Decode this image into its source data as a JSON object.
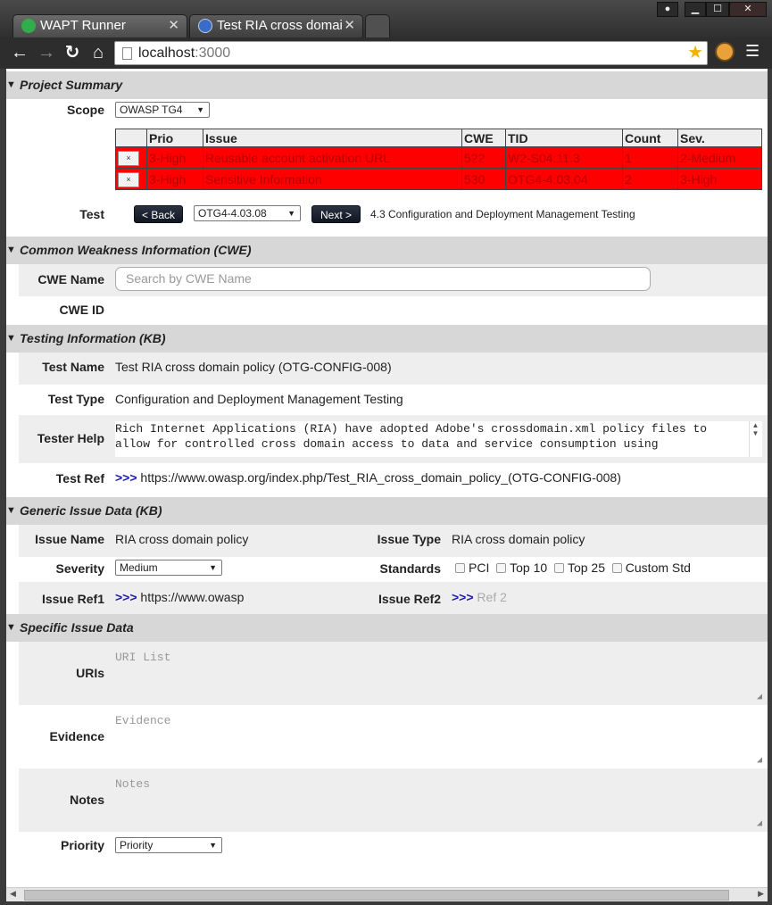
{
  "browser": {
    "tabs": [
      {
        "title": "WAPT Runner",
        "active": false
      },
      {
        "title": "Test RIA cross domai",
        "active": true
      }
    ],
    "url_host": "localhost",
    "url_port": ":3000",
    "icons": {
      "back": "back-arrow-icon",
      "forward": "forward-arrow-icon",
      "reload": "reload-icon",
      "home": "home-icon",
      "star": "star-icon",
      "menu": "menu-icon"
    }
  },
  "project_summary": {
    "header": "Project Summary",
    "scope_label": "Scope",
    "scope_value": "OWASP TG4",
    "table": {
      "columns": [
        "",
        "Prio",
        "Issue",
        "CWE",
        "TID",
        "Count",
        "Sev."
      ],
      "rows": [
        {
          "remove": "×",
          "prio": "3-High",
          "issue": "Reusable account activation URL",
          "cwe": "522",
          "tid": "W2-S04.11.3",
          "count": "1",
          "sev": "2-Medium"
        },
        {
          "remove": "×",
          "prio": "3-High",
          "issue": "Sensitive Information",
          "cwe": "530",
          "tid": "OTG4-4.03.04",
          "count": "2",
          "sev": "3-High"
        }
      ]
    },
    "test_label": "Test",
    "back_button": "< Back",
    "test_select": "OTG4-4.03.08",
    "next_button": "Next >",
    "test_category": "4.3 Configuration and Deployment Management Testing"
  },
  "cwe": {
    "header": "Common Weakness Information (CWE)",
    "name_label": "CWE Name",
    "name_placeholder": "Search by CWE Name",
    "id_label": "CWE ID"
  },
  "testing": {
    "header": "Testing Information (KB)",
    "test_name_label": "Test Name",
    "test_name": "Test RIA cross domain policy (OTG-CONFIG-008)",
    "test_type_label": "Test Type",
    "test_type": "Configuration and Deployment Management Testing",
    "tester_help_label": "Tester Help",
    "tester_help_line1": "Rich Internet Applications (RIA) have adopted Adobe's crossdomain.xml policy files to",
    "tester_help_line2": "allow for controlled cross domain access to data and service consumption using",
    "test_ref_label": "Test Ref",
    "test_ref_arrows": ">>>",
    "test_ref": "https://www.owasp.org/index.php/Test_RIA_cross_domain_policy_(OTG-CONFIG-008)"
  },
  "generic": {
    "header": "Generic Issue Data (KB)",
    "issue_name_label": "Issue Name",
    "issue_name": "RIA cross domain policy",
    "issue_type_label": "Issue Type",
    "issue_type": "RIA cross domain policy",
    "severity_label": "Severity",
    "severity_value": "Medium",
    "standards_label": "Standards",
    "standards": [
      "PCI",
      "Top 10",
      "Top 25",
      "Custom Std"
    ],
    "issue_ref1_label": "Issue Ref1",
    "issue_ref1_arrows": ">>>",
    "issue_ref1": "https://www.owasp",
    "issue_ref2_label": "Issue Ref2",
    "issue_ref2_arrows": ">>>",
    "issue_ref2_placeholder": "Ref 2"
  },
  "specific": {
    "header": "Specific Issue Data",
    "uris_label": "URIs",
    "uris_placeholder": "URI List",
    "evidence_label": "Evidence",
    "evidence_placeholder": "Evidence",
    "notes_label": "Notes",
    "notes_placeholder": "Notes",
    "priority_label": "Priority",
    "priority_value": "Priority"
  },
  "colors": {
    "issue_row_bg": "#ff0000",
    "issue_row_text": "#b80000",
    "section_bg": "#d7d7d7",
    "row_alt_bg": "#eeeeee",
    "link_arrows": "#1b1bb0"
  }
}
